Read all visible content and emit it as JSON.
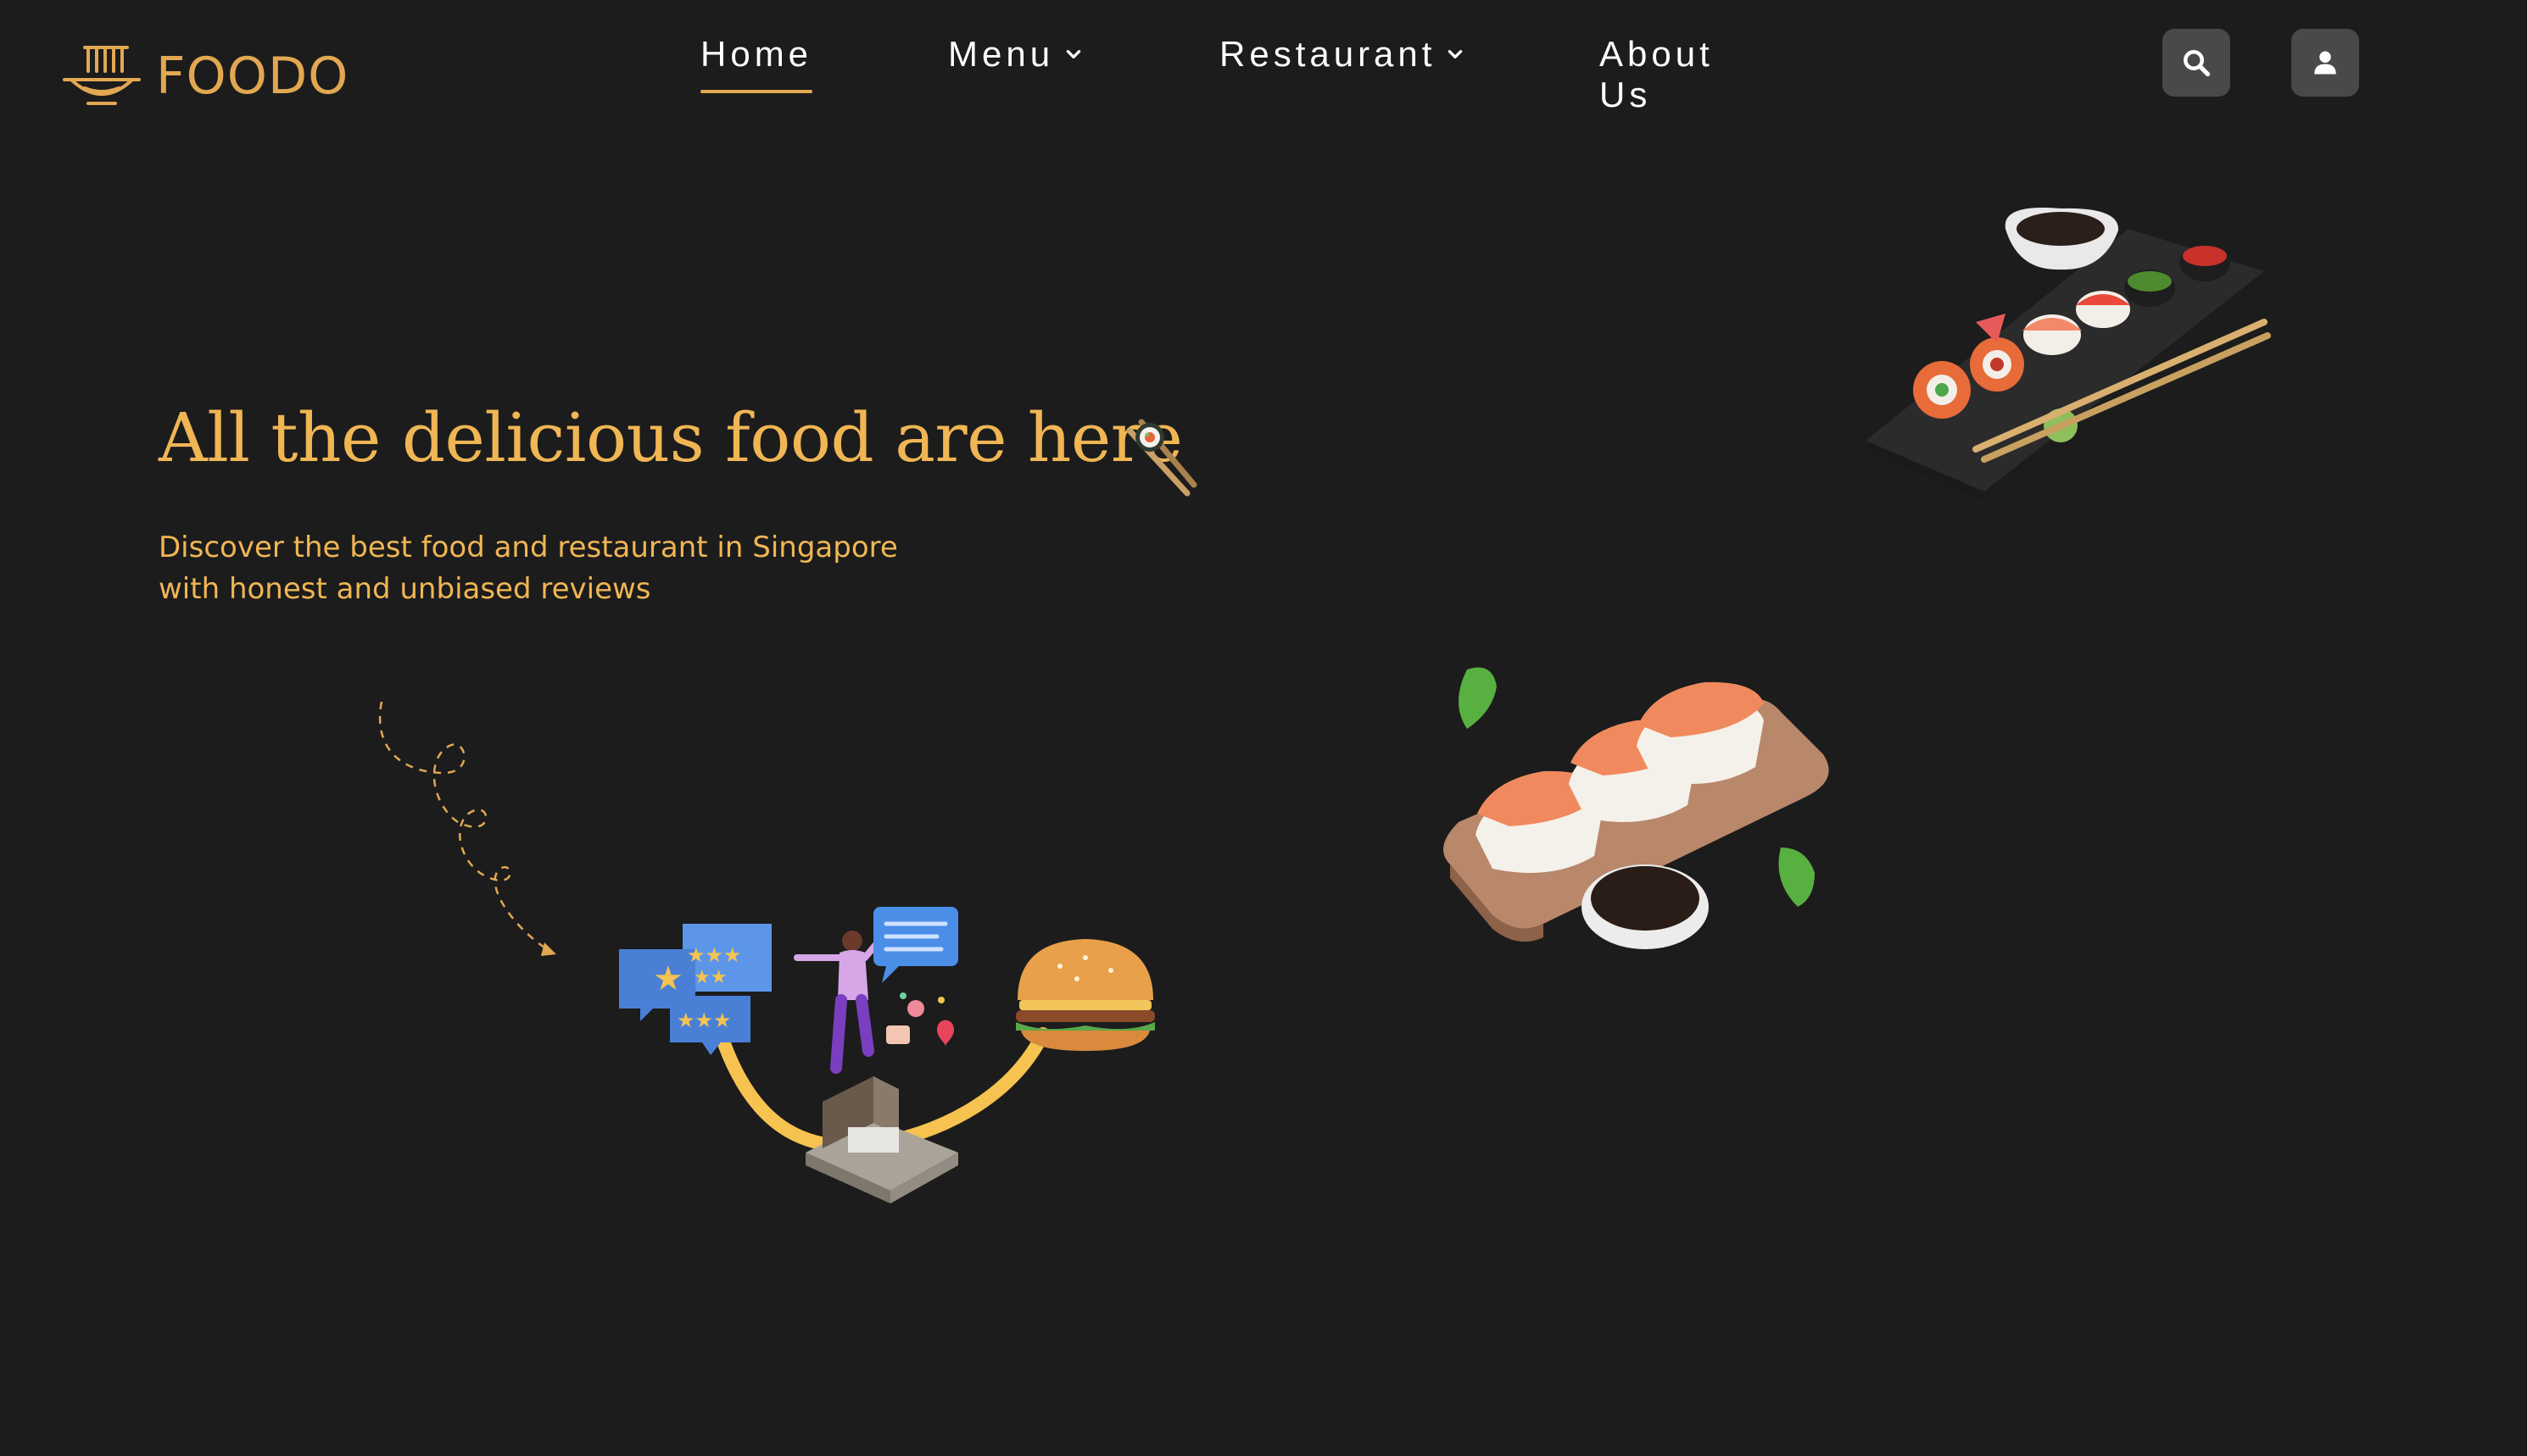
{
  "brand": {
    "name": "FOODO",
    "logo_icon": "noodle-bowl-icon",
    "accent": "#e2a851"
  },
  "nav": {
    "items": [
      {
        "label": "Home",
        "active": true,
        "has_dropdown": false
      },
      {
        "label": "Menu",
        "active": false,
        "has_dropdown": true
      },
      {
        "label": "Restaurant",
        "active": false,
        "has_dropdown": true
      },
      {
        "label": "About Us",
        "active": false,
        "has_dropdown": false
      }
    ]
  },
  "actions": {
    "search_icon": "search-icon",
    "user_icon": "user-icon"
  },
  "hero": {
    "title": "All the delicious food are here",
    "subtitle_line1": "Discover the best food and restaurant in Singapore",
    "subtitle_line2": "with honest and unbiased reviews"
  },
  "colors": {
    "background": "#1c1c1c",
    "title": "#f0b654",
    "button_bg": "#4a4848"
  }
}
